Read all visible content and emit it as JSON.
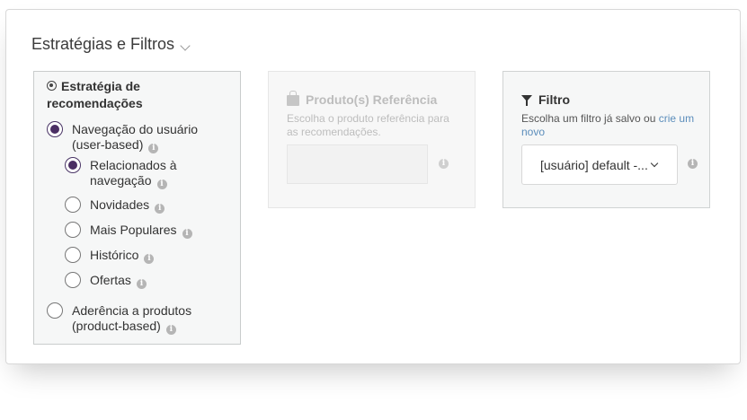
{
  "section": {
    "title": "Estratégias e Filtros"
  },
  "strategy": {
    "title": "Estratégia de recomendações",
    "options": [
      {
        "label": "Navegação do usuário (user-based)",
        "checked": true
      },
      {
        "label": "Aderência a produtos (product-based)",
        "checked": false
      }
    ],
    "sub_options": [
      {
        "label": "Relacionados à navegação",
        "checked": true
      },
      {
        "label": "Novidades",
        "checked": false
      },
      {
        "label": "Mais Populares",
        "checked": false
      },
      {
        "label": "Histórico",
        "checked": false
      },
      {
        "label": "Ofertas",
        "checked": false
      }
    ]
  },
  "reference": {
    "title": "Produto(s) Referência",
    "description": "Escolha o produto referência para as recomendações.",
    "input_value": ""
  },
  "filter": {
    "title": "Filtro",
    "description": "Escolha um filtro já salvo ou ",
    "link_text": "crie um novo",
    "selected_value": "[usuário] default -..."
  },
  "icons": {
    "info": "i"
  },
  "colors": {
    "radio_checked": "#4a2e63",
    "link": "#5b8dbb",
    "panel_bg": "#f6f7f7"
  }
}
